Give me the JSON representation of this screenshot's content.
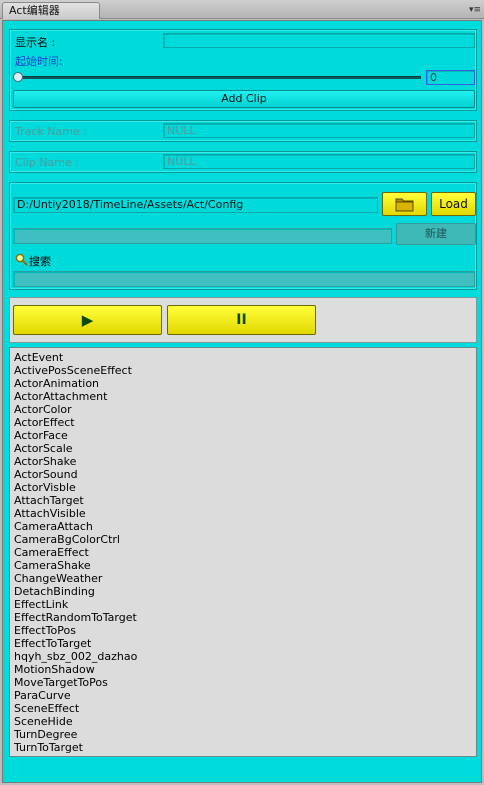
{
  "window": {
    "tab_title": "Act编辑器",
    "menu_icon": "▾≡"
  },
  "clip_section": {
    "display_name_label": "显示名 :",
    "display_name_value": "",
    "start_time_label": "起始时间:",
    "start_time_value": "0",
    "start_time_slider": 0,
    "add_clip_label": "Add Clip"
  },
  "track_section": {
    "track_name_label": "Track Name :",
    "track_name_value": "NULL"
  },
  "clip_name_section": {
    "clip_name_label": "Clip Name :",
    "clip_name_value": "NULL"
  },
  "config_section": {
    "path_value": "D:/Untiy2018/TimeLine/Assets/Act/Config",
    "folder_icon": "folder-icon",
    "load_label": "Load",
    "new_name_value": "",
    "new_label": "新建",
    "search_label": "搜索",
    "search_value": ""
  },
  "playback": {
    "play_glyph": "▶",
    "pause_glyph": "II"
  },
  "action_list": [
    "ActEvent",
    "ActivePosSceneEffect",
    "ActorAnimation",
    "ActorAttachment",
    "ActorColor",
    "ActorEffect",
    "ActorFace",
    "ActorScale",
    "ActorShake",
    "ActorSound",
    "ActorVisble",
    "AttachTarget",
    "AttachVisible",
    "CameraAttach",
    "CameraBgColorCtrl",
    "CameraEffect",
    "CameraShake",
    "ChangeWeather",
    "DetachBinding",
    "EffectLink",
    "EffectRandomToTarget",
    "EffectToPos",
    "EffectToTarget",
    "hqyh_sbz_002_dazhao",
    "MotionShadow",
    "MoveTargetToPos",
    "ParaCurve",
    "SceneEffect",
    "SceneHide",
    "TurnDegree",
    "TurnToTarget"
  ],
  "colors": {
    "panel_bg": "#00dcdc",
    "button_yellow": "#f0e800",
    "list_bg": "#dcdcdc"
  }
}
